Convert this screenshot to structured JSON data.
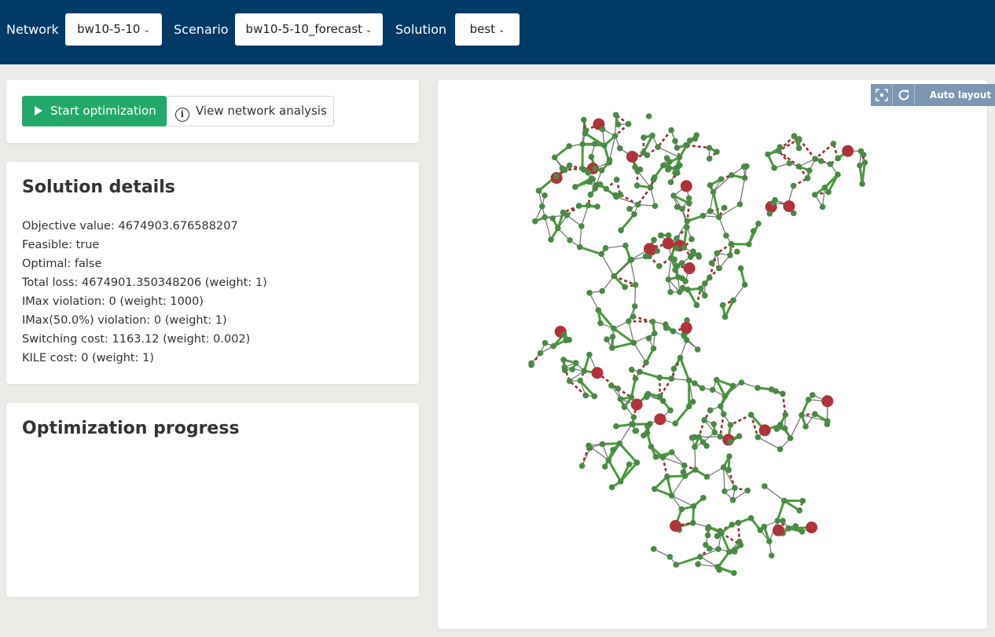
{
  "header": {
    "network_label": "Network",
    "network_value": "bw10-5-10",
    "scenario_label": "Scenario",
    "scenario_value": "bw10-5-10_forecast",
    "solution_label": "Solution",
    "solution_value": "best"
  },
  "actions": {
    "start_label": "Start optimization",
    "analysis_label": "View network analysis"
  },
  "solution_details": {
    "title": "Solution details",
    "lines": [
      "Objective value: 4674903.676588207",
      "Feasible: true",
      "Optimal: false",
      "Total loss: 4674901.350348206 (weight: 1)",
      "IMax violation: 0 (weight: 1000)",
      "IMax(50.0%) violation: 0 (weight: 1)",
      "Switching cost: 1163.12 (weight: 0.002)",
      "KILE cost: 0 (weight: 1)"
    ]
  },
  "progress": {
    "title": "Optimization progress"
  },
  "map": {
    "auto_layout_label": "Auto layout",
    "fit_icon": "fit-to-screen-icon",
    "refresh_icon": "refresh-icon"
  },
  "colors": {
    "header_bg": "#003a66",
    "start_button": "#22a96a",
    "node": "#4a8a45",
    "source_node": "#b0323a",
    "active_line": "#4c9a3f",
    "open_line": "#963232",
    "thin_line": "#6f6f6f"
  }
}
